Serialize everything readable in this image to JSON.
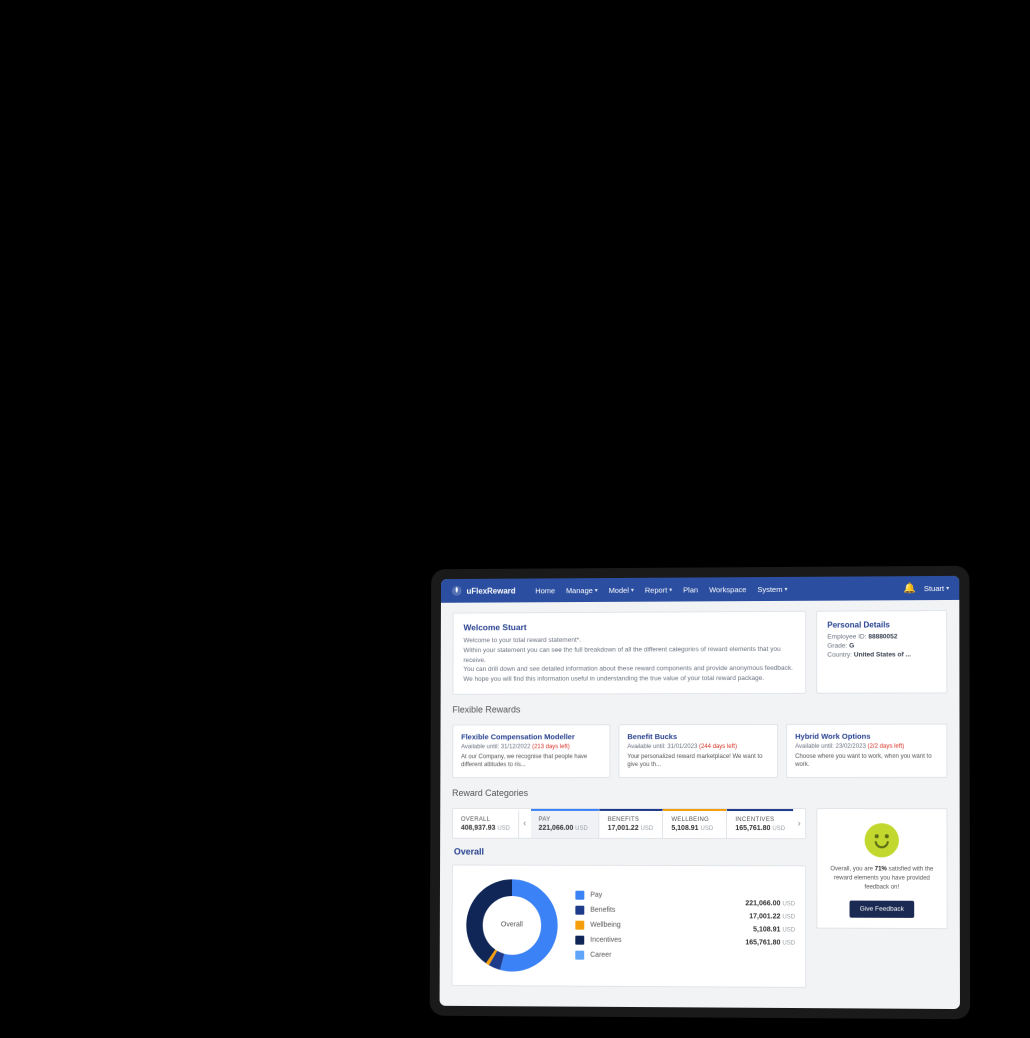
{
  "brand": "uFlexReward",
  "nav": [
    "Home",
    "Manage",
    "Model",
    "Report",
    "Plan",
    "Workspace",
    "System"
  ],
  "nav_dropdown": [
    false,
    true,
    true,
    true,
    false,
    false,
    true
  ],
  "user": "Stuart",
  "welcome": {
    "title": "Welcome Stuart",
    "p1": "Welcome to your total reward statement*.",
    "p2": "Within your statement you can see the full breakdown of all the different categories of reward elements that you receive.",
    "p3": "You can drill down and see detailed information about these reward components and provide anonymous feedback.",
    "p4": "We hope you will find this information useful in understanding the true value of your total reward package."
  },
  "details": {
    "heading": "Personal Details",
    "employee_id_label": "Employee ID:",
    "employee_id": "88880052",
    "grade_label": "Grade:",
    "grade": "G",
    "country_label": "Country:",
    "country": "United States of ..."
  },
  "flex_title": "Flexible Rewards",
  "flex_cards": [
    {
      "title": "Flexible Compensation Modeller",
      "avail": "Available until: 31/12/2022",
      "days": "(213 days left)",
      "desc": "At our Company, we recognise that people have different attitudes to ris..."
    },
    {
      "title": "Benefit Bucks",
      "avail": "Available until: 31/01/2023",
      "days": "(244 days left)",
      "desc": "Your personalized reward marketplace! We want to give you th..."
    },
    {
      "title": "Hybrid Work Options",
      "avail": "Available until: 23/02/2023",
      "days": "(2/2 days left)",
      "desc": "Choose where you want to work, when you want to work."
    }
  ],
  "cat_title": "Reward Categories",
  "tabs": {
    "overall": {
      "label": "OVERALL",
      "value": "408,937.93",
      "currency": "USD"
    },
    "pay": {
      "label": "PAY",
      "value": "221,066.00",
      "currency": "USD"
    },
    "benefits": {
      "label": "BENEFITS",
      "value": "17,001.22",
      "currency": "USD"
    },
    "wellbeing": {
      "label": "WELLBEING",
      "value": "5,108.91",
      "currency": "USD"
    },
    "incentives": {
      "label": "INCENTIVES",
      "value": "165,761.80",
      "currency": "USD"
    }
  },
  "overall_heading": "Overall",
  "donut_center": "Overall",
  "legend": [
    {
      "name": "Pay",
      "color": "#3b82f6",
      "value": "221,066.00",
      "currency": "USD"
    },
    {
      "name": "Benefits",
      "color": "#1e3a8a",
      "value": "17,001.22",
      "currency": "USD"
    },
    {
      "name": "Wellbeing",
      "color": "#f59e0b",
      "value": "5,108.91",
      "currency": "USD"
    },
    {
      "name": "Incentives",
      "color": "#1e3a8a",
      "value": "165,761.80",
      "currency": "USD"
    },
    {
      "name": "Career",
      "color": "#60a5fa",
      "value": "",
      "currency": ""
    }
  ],
  "feedback": {
    "pre": "Overall, you are ",
    "pct": "71%",
    "post": " satisfied with the reward elements you have provided feedback on!",
    "button": "Give Feedback"
  },
  "chart_data": {
    "type": "pie",
    "title": "Overall",
    "series": [
      {
        "name": "Pay",
        "value": 221066.0,
        "color": "#3b82f6"
      },
      {
        "name": "Benefits",
        "value": 17001.22,
        "color": "#1e3a8a"
      },
      {
        "name": "Wellbeing",
        "value": 5108.91,
        "color": "#f59e0b"
      },
      {
        "name": "Incentives",
        "value": 165761.8,
        "color": "#1e3a8a"
      },
      {
        "name": "Career",
        "value": 0,
        "color": "#60a5fa"
      }
    ],
    "total": 408937.93,
    "currency": "USD"
  }
}
